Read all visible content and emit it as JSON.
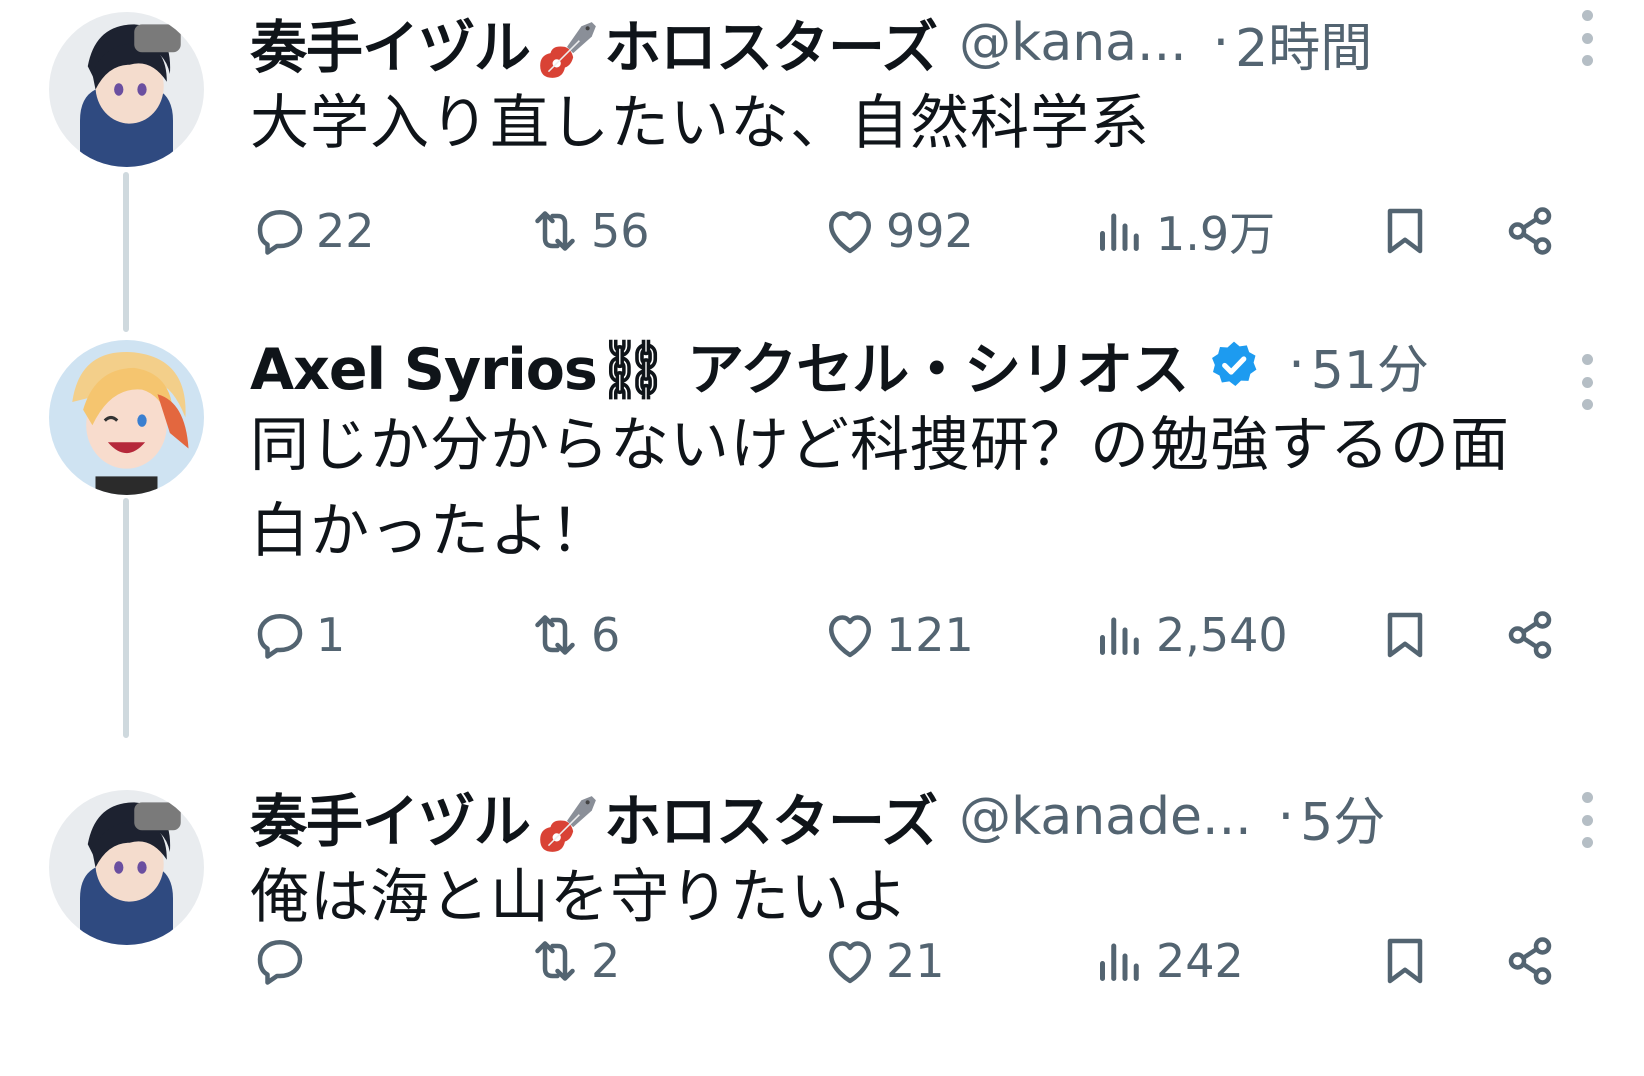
{
  "tweets": [
    {
      "name_part1": "奏手イヅル",
      "name_part2": "ホロスターズ",
      "handle": "@kana...",
      "dot": "·",
      "time": "2時間",
      "text_lines": [
        "大学入り直したいな、自然科学系"
      ],
      "reply_count": "22",
      "retweet_count": "56",
      "like_count": "992",
      "view_count": "1.9万"
    },
    {
      "name": "Axel Syrios⛓ アクセル・シリオス",
      "dot": "·",
      "time": "51分",
      "text_lines": [
        "同じか分からないけど科捜研？の勉強するの面",
        "白かったよ！"
      ],
      "reply_count": "1",
      "retweet_count": "6",
      "like_count": "121",
      "view_count": "2,540"
    },
    {
      "name_part1": "奏手イヅル",
      "name_part2": "ホロスターズ",
      "handle": "@kanade...",
      "dot": "·",
      "time": "5分",
      "text_lines": [
        "俺は海と山を守りたいよ"
      ],
      "reply_count": "",
      "retweet_count": "2",
      "like_count": "21",
      "view_count": "242"
    }
  ],
  "colors": {
    "text": "#0f1419",
    "muted": "#536471",
    "thread_line": "#cfd9de",
    "verified": "#1d9bf0"
  },
  "icons": [
    "reply-icon",
    "retweet-icon",
    "like-icon",
    "views-icon",
    "bookmark-icon",
    "share-icon",
    "more-icon",
    "verified-badge-icon",
    "guitar-emoji-icon"
  ]
}
